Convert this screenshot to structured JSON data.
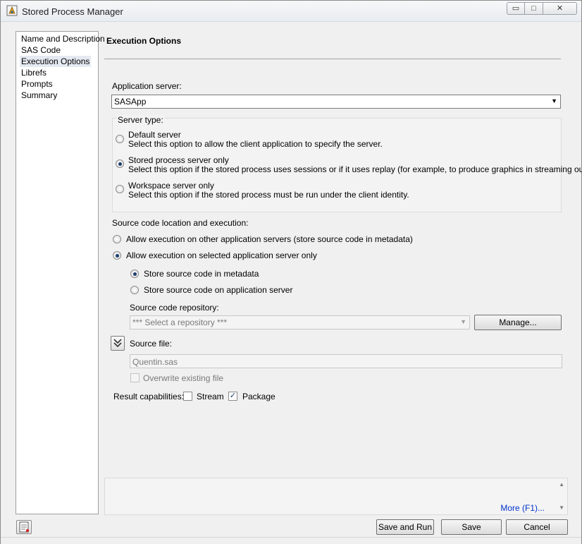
{
  "window": {
    "title": "Stored Process Manager"
  },
  "titlebar_buttons": {
    "minimize": "▭",
    "maximize": "□",
    "close": "✕"
  },
  "nav": {
    "items": [
      {
        "label": "Name and Description"
      },
      {
        "label": "SAS Code"
      },
      {
        "label": "Execution Options",
        "selected": true
      },
      {
        "label": "Librefs"
      },
      {
        "label": "Prompts"
      },
      {
        "label": "Summary"
      }
    ]
  },
  "main": {
    "section_title": "Execution Options",
    "application_server": {
      "label": "Application server:",
      "value": "SASApp"
    },
    "server_type": {
      "legend": "Server type:",
      "options": [
        {
          "title": "Default server",
          "desc": "Select this option to allow the client application to specify the server.",
          "selected": false
        },
        {
          "title": "Stored process server only",
          "desc": "Select this option if the stored process uses sessions or if it uses replay (for example, to produce graphics in streaming output).",
          "selected": true
        },
        {
          "title": "Workspace server only",
          "desc": "Select this option if the stored process must be run under the client identity.",
          "selected": false
        }
      ]
    },
    "source_code": {
      "label": "Source code location and execution:",
      "options": [
        {
          "label": "Allow execution on other application servers (store source code in metadata)",
          "selected": false
        },
        {
          "label": "Allow execution on selected application server only",
          "selected": true
        }
      ],
      "sub_options": [
        {
          "label": "Store source code in metadata",
          "selected": true
        },
        {
          "label": "Store source code on application server",
          "selected": false
        }
      ],
      "repository_label": "Source code repository:",
      "repository_placeholder": "*** Select a repository ***",
      "manage_button": "Manage...",
      "source_file_label": "Source file:",
      "source_file_value": "Quentin.sas",
      "overwrite_label": "Overwrite existing file"
    },
    "result_capabilities": {
      "label": "Result capabilities:",
      "stream": {
        "label": "Stream",
        "checked": false
      },
      "package": {
        "label": "Package",
        "checked": true
      }
    }
  },
  "help": {
    "more_link": "More (F1)..."
  },
  "footer": {
    "save_and_run": "Save and Run",
    "save": "Save",
    "cancel": "Cancel"
  }
}
